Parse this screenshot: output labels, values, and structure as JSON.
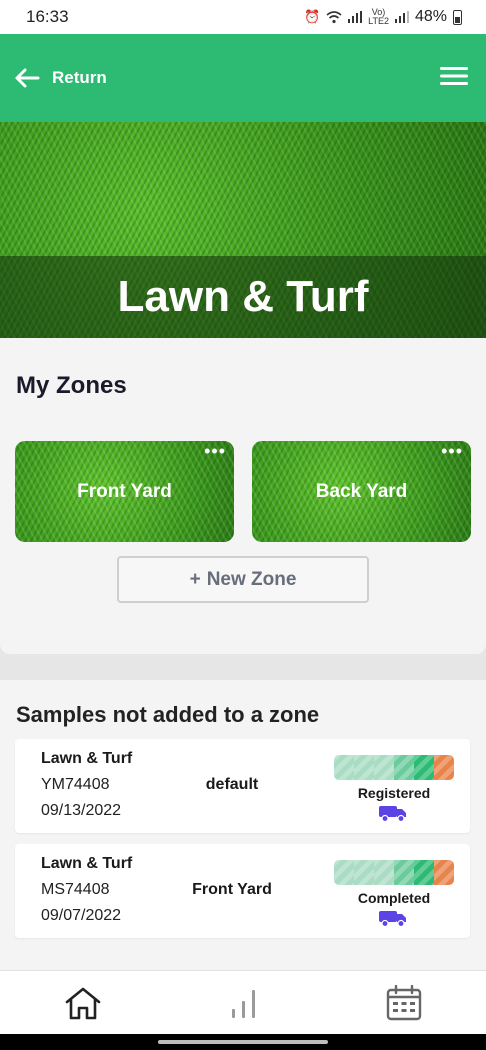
{
  "status_bar": {
    "time": "16:33",
    "battery_percent": "48%",
    "network_label": "LTE2",
    "icons": [
      "alarm-icon",
      "wifi-icon",
      "signal-icon",
      "volte-icon",
      "battery-icon"
    ]
  },
  "header": {
    "return_label": "Return",
    "background": "#2dbb73",
    "icons": [
      "arrow-left-icon",
      "hamburger-menu-icon"
    ]
  },
  "hero": {
    "title": "Lawn & Turf"
  },
  "zones": {
    "title": "My Zones",
    "items": [
      {
        "name": "Front Yard",
        "menu": "•••"
      },
      {
        "name": "Back Yard",
        "menu": "•••"
      }
    ],
    "new_zone": {
      "icon": "+",
      "label": "New Zone"
    }
  },
  "samples": {
    "title": "Samples not added to a zone",
    "items": [
      {
        "type": "Lawn & Turf",
        "id": "YM74408",
        "date": "09/13/2022",
        "zone": "default",
        "status": "Registered",
        "progress_colors": [
          "#a9dcc3",
          "#a9dcc3",
          "#a9dcc3",
          "#6ccb9b",
          "#2dbb73",
          "#e8834a"
        ],
        "icon": "truck-icon"
      },
      {
        "type": "Lawn & Turf",
        "id": "MS74408",
        "date": "09/07/2022",
        "zone": "Front Yard",
        "status": "Completed",
        "progress_colors": [
          "#a9dcc3",
          "#a9dcc3",
          "#a9dcc3",
          "#6ccb9b",
          "#2dbb73",
          "#e8834a"
        ],
        "icon": "truck-icon"
      }
    ]
  },
  "bottom_nav": {
    "items": [
      "home-icon",
      "bar-chart-icon",
      "calendar-icon"
    ]
  },
  "colors": {
    "accent_green": "#2dbb73",
    "truck_purple": "#5b43e6",
    "progress_orange": "#e8834a"
  }
}
